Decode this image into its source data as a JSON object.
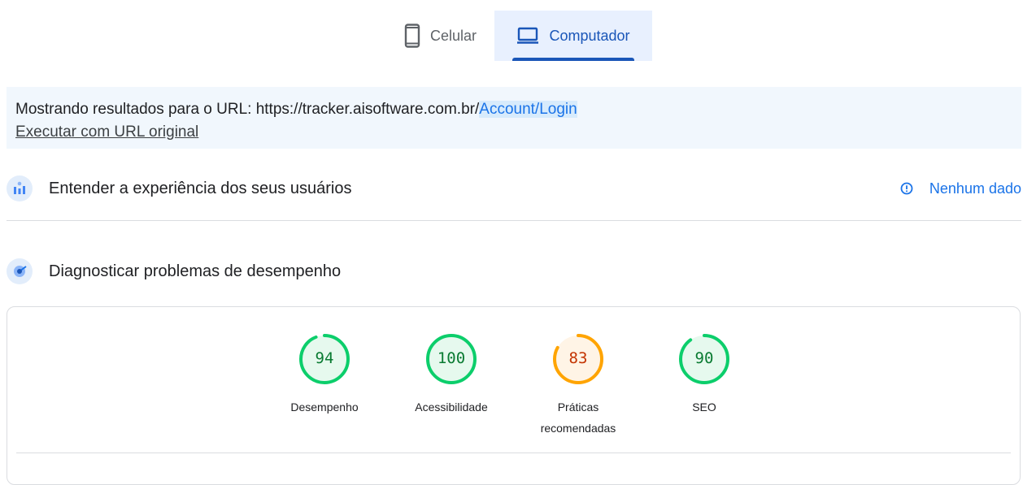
{
  "tabs": [
    {
      "label": "Celular",
      "icon": "smartphone-icon",
      "selected": false
    },
    {
      "label": "Computador",
      "icon": "laptop-icon",
      "selected": true
    }
  ],
  "url_banner": {
    "prefix": "Mostrando resultados para o URL: https://tracker.aisoftware.com.br/",
    "path": "Account/Login",
    "original_link": "Executar com URL original"
  },
  "field_section": {
    "title": "Entender a experiência dos seus usuários",
    "status": "Nenhum dado",
    "icon": "crux-chart-icon"
  },
  "lab_section": {
    "title": "Diagnosticar problemas de desempenho",
    "icon": "lighthouse-icon"
  },
  "scores": [
    {
      "label": "Desempenho",
      "value": 94,
      "display": "94",
      "status": "pass"
    },
    {
      "label": "Acessibilidade",
      "value": 100,
      "display": "100",
      "status": "pass"
    },
    {
      "label_line1": "Práticas",
      "label_line2": "recomendadas",
      "value": 83,
      "display": "83",
      "status": "average"
    },
    {
      "label": "SEO",
      "value": 90,
      "display": "90",
      "status": "pass"
    }
  ],
  "colors": {
    "pass_stroke": "#0cce6b",
    "pass_fill": "#e6f9ee",
    "pass_text": "#0a7b32",
    "average_stroke": "#ffa400",
    "average_fill": "#fff4e6",
    "average_text": "#c33300",
    "accent": "#1a73e8",
    "tab_selected": "#1a56b8"
  }
}
